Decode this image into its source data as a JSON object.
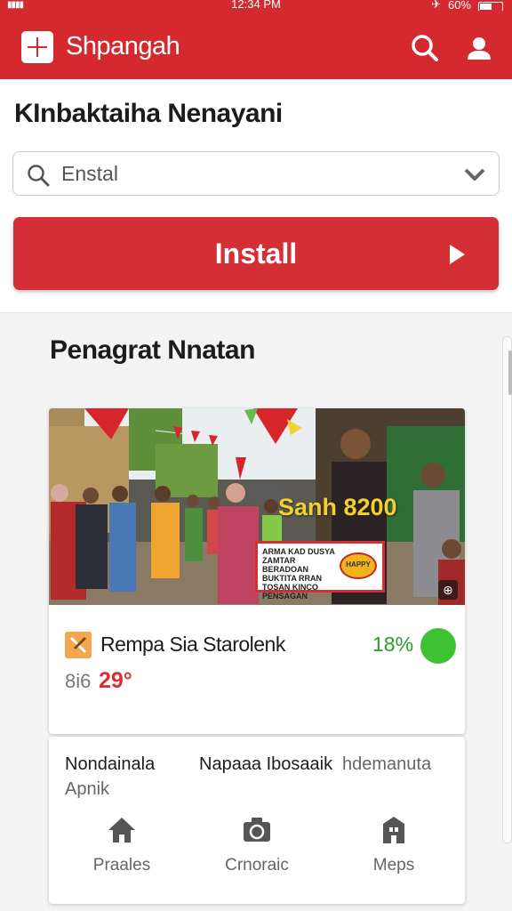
{
  "status": {
    "time": "12:34 PM",
    "battery": "60%",
    "signal": "▮▮▮▮"
  },
  "header": {
    "app_name": "Shpangah"
  },
  "top": {
    "title": "KInbaktaiha Nenayani",
    "search": {
      "value": "Enstal",
      "placeholder": "Enstal"
    },
    "install_label": "Install"
  },
  "section": {
    "title": "Penagrat Nnatan"
  },
  "listing": {
    "photo": {
      "price_overlay": "Sanh 8200",
      "sign_text": "ARMA KAD DUSYA ZAMTAR BERADOAN BUKTITA RRAN TOSAN KINCO PENSAGAN",
      "badge": "HAPPY"
    },
    "name": "Rempa Sia Starolenk",
    "percent": "18%",
    "old_price": "8i6",
    "new_price": "29°"
  },
  "card2": {
    "col1": "Nondainala",
    "col2": "Napaaa Ibosaaik",
    "col3": "hdemanuta",
    "col4": "Apnik",
    "nav": [
      {
        "label": "Praales",
        "icon": "home-icon"
      },
      {
        "label": "Crnoraic",
        "icon": "camera-icon"
      },
      {
        "label": "Meps",
        "icon": "building-icon"
      }
    ]
  },
  "colors": {
    "brand": "#d42a2f",
    "accent_green": "#3ec132",
    "price_red": "#d42f34"
  }
}
